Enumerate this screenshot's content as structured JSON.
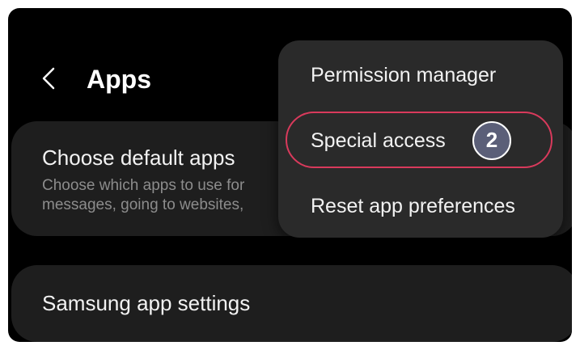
{
  "header": {
    "title": "Apps",
    "back_icon": "chevron-left-icon"
  },
  "cards": {
    "default_apps": {
      "title": "Choose default apps",
      "subtitle_line1": "Choose which apps to use for",
      "subtitle_line2": "messages, going to websites,"
    },
    "samsung_settings": {
      "title": "Samsung app settings"
    }
  },
  "menu": {
    "items": [
      {
        "label": "Permission manager"
      },
      {
        "label": "Special access"
      },
      {
        "label": "Reset app preferences"
      }
    ]
  },
  "annotation": {
    "step_number": "2",
    "highlight_color": "#d93a5c",
    "badge_color": "#5b5f78"
  }
}
